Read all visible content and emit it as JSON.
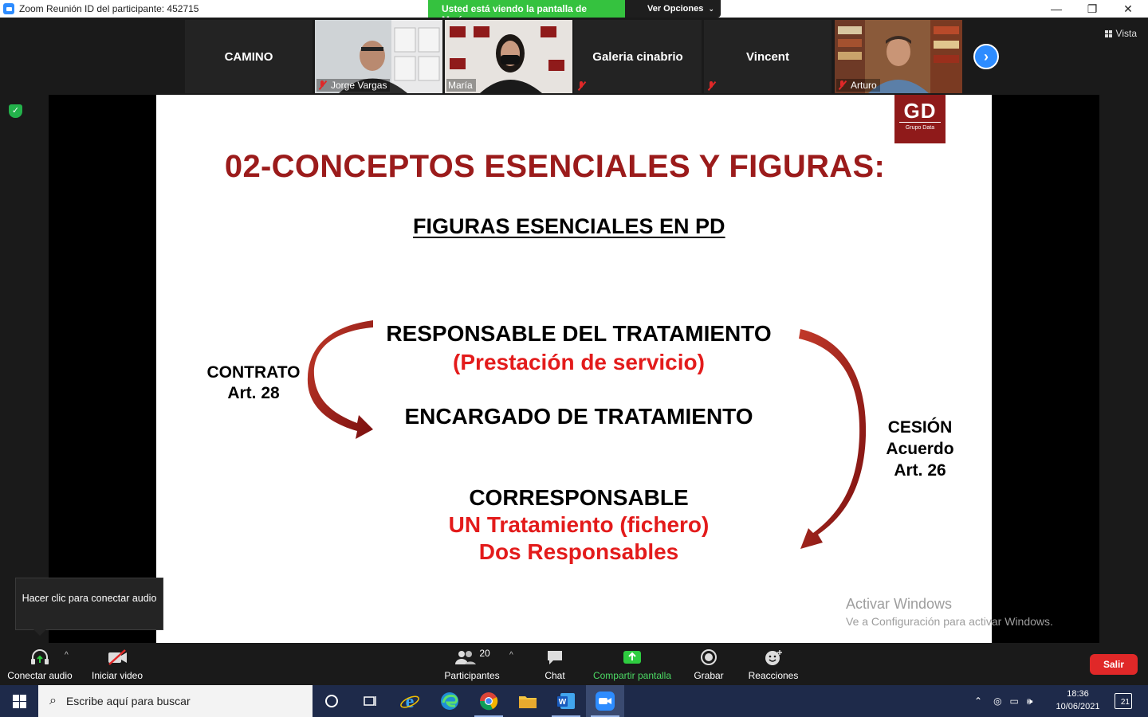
{
  "titlebar": {
    "title": "Zoom Reunión ID del participante: 452715",
    "banner": "Usted está viendo la pantalla de María",
    "options": "Ver Opciones",
    "minimize": "—",
    "maximize": "❐",
    "close": "✕"
  },
  "gallery": {
    "tiles": [
      {
        "name": "CAMINO"
      },
      {
        "name": "Jorge Vargas"
      },
      {
        "name": "María"
      },
      {
        "name": "Galeria cinabrio"
      },
      {
        "name": "Vincent"
      },
      {
        "name": "Arturo"
      }
    ],
    "view_label": "Vista"
  },
  "slide": {
    "logo": "GD",
    "logo_sub": "Grupo Data",
    "title": "02-CONCEPTOS ESENCIALES Y FIGURAS:",
    "subtitle": "FIGURAS ESENCIALES EN PD",
    "responsable": "RESPONSABLE DEL TRATAMIENTO",
    "prestacion": "(Prestación de servicio)",
    "contrato": "CONTRATO",
    "art28": "Art. 28",
    "encargado": "ENCARGADO DE TRATAMIENTO",
    "cesion": "CESIÓN",
    "acuerdo": "Acuerdo",
    "art26": "Art. 26",
    "corresponsable": "CORRESPONSABLE",
    "un_tratamiento": "UN Tratamiento (fichero)",
    "dos_responsables": "Dos Responsables"
  },
  "watermark": {
    "line1": "Activar Windows",
    "line2": "Ve a Configuración para activar Windows."
  },
  "tooltip": {
    "text": "Hacer clic para conectar audio"
  },
  "toolbar": {
    "audio": "Conectar audio",
    "video": "Iniciar video",
    "participants": "Participantes",
    "participants_count": "20",
    "chat": "Chat",
    "share": "Compartir pantalla",
    "record": "Grabar",
    "reactions": "Reacciones",
    "leave": "Salir"
  },
  "taskbar": {
    "search_placeholder": "Escribe aquí para buscar",
    "time": "18:36",
    "date": "10/06/2021",
    "notifications": "21"
  },
  "colors": {
    "slide_title": "#9b1b1b",
    "slide_red": "#e31b1b",
    "share_banner": "#35c23f",
    "zoom_blue": "#2d8cff",
    "leave_red": "#e02828"
  }
}
